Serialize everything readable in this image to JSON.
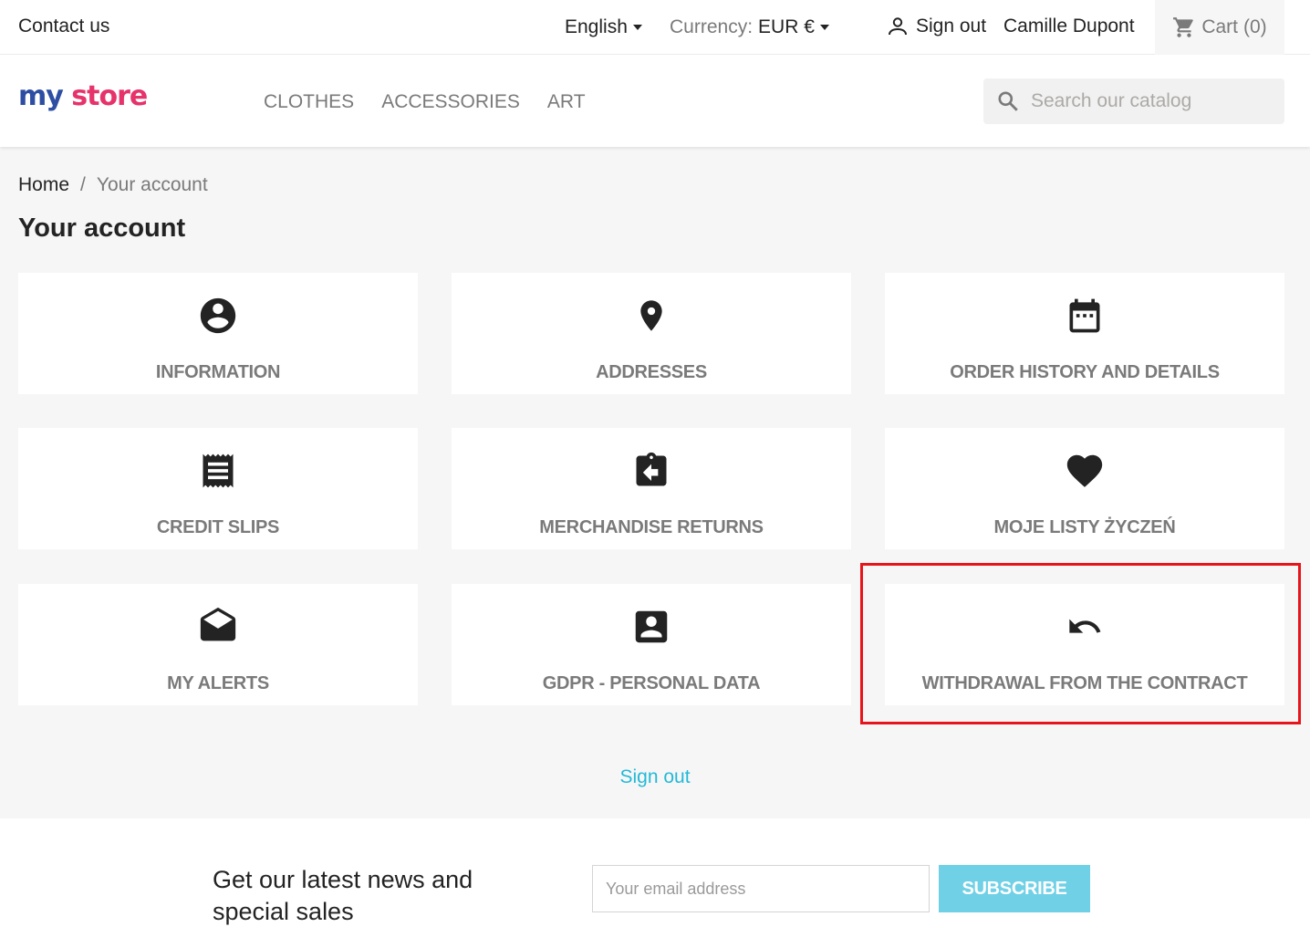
{
  "topbar": {
    "contact": "Contact us",
    "language": "English",
    "currency_label": "Currency:",
    "currency_value": "EUR €",
    "sign_out": "Sign out",
    "user_name": "Camille Dupont",
    "cart_label": "Cart",
    "cart_count": "(0)"
  },
  "header": {
    "logo_part1": "my",
    "logo_part2": "store",
    "nav": [
      "CLOTHES",
      "ACCESSORIES",
      "ART"
    ],
    "search_placeholder": "Search our catalog"
  },
  "breadcrumb": {
    "home": "Home",
    "separator": "/",
    "current": "Your account"
  },
  "page_title": "Your account",
  "tiles": [
    {
      "label": "INFORMATION",
      "icon": "account-circle-icon"
    },
    {
      "label": "ADDRESSES",
      "icon": "location-pin-icon"
    },
    {
      "label": "ORDER HISTORY AND DETAILS",
      "icon": "calendar-icon"
    },
    {
      "label": "CREDIT SLIPS",
      "icon": "receipt-icon"
    },
    {
      "label": "MERCHANDISE RETURNS",
      "icon": "assignment-return-icon"
    },
    {
      "label": "MOJE LISTY ŻYCZEŃ",
      "icon": "heart-icon"
    },
    {
      "label": "MY ALERTS",
      "icon": "envelope-open-icon"
    },
    {
      "label": "GDPR - PERSONAL DATA",
      "icon": "account-box-icon"
    },
    {
      "label": "WITHDRAWAL FROM THE CONTRACT",
      "icon": "undo-icon"
    }
  ],
  "sign_out_link": "Sign out",
  "newsletter": {
    "text": "Get our latest news and special sales",
    "email_placeholder": "Your email address",
    "subscribe": "SUBSCRIBE"
  },
  "colors": {
    "accent": "#24b9d7",
    "subscribe": "#6fd0e6",
    "highlight": "#e8141c"
  }
}
